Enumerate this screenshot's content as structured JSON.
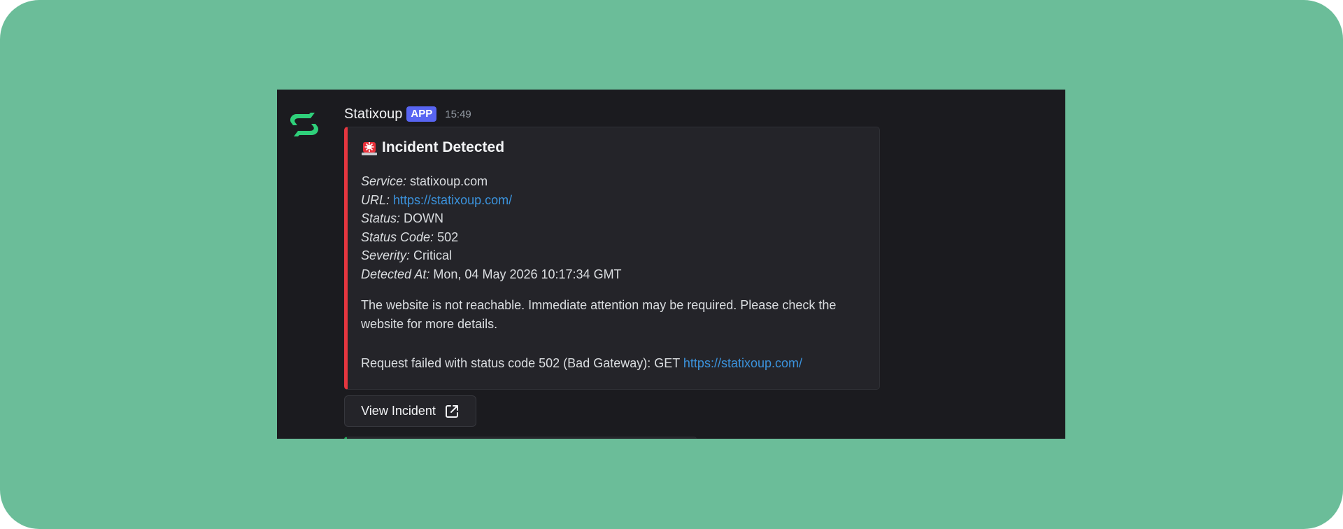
{
  "message": {
    "author": "Statixoup",
    "badge": "APP",
    "timestamp": "15:49",
    "avatar_icon": "statixoup-logo-icon",
    "accent_color": "#2fd07a"
  },
  "embed": {
    "accent_color": "#e5363f",
    "title_icon": "rotating-light-siren-icon",
    "title": "Incident Detected",
    "fields": [
      {
        "key": "Service:",
        "value": "statixoup.com",
        "is_link": false
      },
      {
        "key": "URL:",
        "value": "https://statixoup.com/",
        "is_link": true
      },
      {
        "key": "Status:",
        "value": "DOWN",
        "is_link": false
      },
      {
        "key": "Status Code:",
        "value": "502",
        "is_link": false
      },
      {
        "key": "Severity:",
        "value": "Critical",
        "is_link": false
      },
      {
        "key": "Detected At:",
        "value": "Mon, 04 May 2026 10:17:34 GMT",
        "is_link": false
      }
    ],
    "description": "The website is not reachable. Immediate attention may be required. Please check the website for more details.",
    "request_text": "Request failed with status code 502 (Bad Gateway): GET",
    "request_link": "https://statixoup.com/"
  },
  "button": {
    "label": "View Incident",
    "icon": "external-link-icon"
  },
  "colors": {
    "background": "#6bbd99",
    "chat_bg": "#1b1b1f",
    "embed_bg": "#242429",
    "link": "#3b93dd",
    "badge_bg": "#5865f2"
  }
}
